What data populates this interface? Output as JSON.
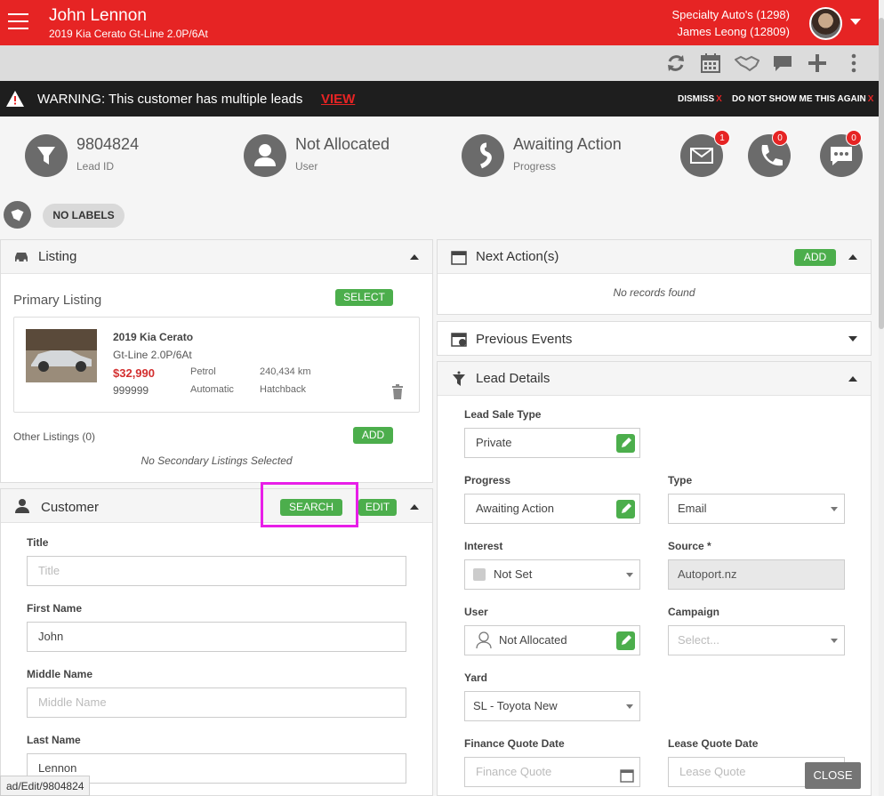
{
  "header": {
    "customer_name": "John Lennon",
    "vehicle": "2019 Kia Cerato Gt-Line 2.0P/6At",
    "dealer": "Specialty Auto's (1298)",
    "user": "James Leong (12809)"
  },
  "toolbar": {
    "icons": [
      "refresh-icon",
      "calendar-icon",
      "handshake-icon",
      "chat-icon",
      "plus-icon",
      "more-vertical-icon"
    ]
  },
  "warning": {
    "text": "WARNING: This customer has multiple leads",
    "view": "VIEW",
    "dismiss": "DISMISS",
    "never_show": "DO NOT SHOW ME THIS AGAIN",
    "x": "X"
  },
  "stats": {
    "lead_id": {
      "value": "9804824",
      "label": "Lead ID"
    },
    "user": {
      "value": "Not Allocated",
      "label": "User"
    },
    "progress": {
      "value": "Awaiting Action",
      "label": "Progress"
    },
    "email_count": "1",
    "call_count": "0",
    "sms_count": "0"
  },
  "labels": {
    "no_labels": "NO LABELS"
  },
  "listing": {
    "title": "Listing",
    "primary_label": "Primary Listing",
    "select": "SELECT",
    "car_title": "2019 Kia Cerato",
    "car_variant": "Gt-Line 2.0P/6At",
    "price": "$32,990",
    "stock": "999999",
    "fuel": "Petrol",
    "transmission": "Automatic",
    "odometer": "240,434 km",
    "body": "Hatchback",
    "other_label": "Other Listings (0)",
    "add": "ADD",
    "no_secondary": "No Secondary Listings Selected"
  },
  "customer": {
    "title": "Customer",
    "search": "SEARCH",
    "edit": "EDIT",
    "fields": {
      "title_label": "Title",
      "title_placeholder": "Title",
      "first_label": "First Name",
      "first_value": "John",
      "middle_label": "Middle Name",
      "middle_placeholder": "Middle Name",
      "last_label": "Last Name",
      "last_value": "Lennon"
    }
  },
  "next_actions": {
    "title": "Next Action(s)",
    "add": "ADD",
    "empty": "No records found"
  },
  "previous_events": {
    "title": "Previous Events"
  },
  "lead_details": {
    "title": "Lead Details",
    "sale_type_label": "Lead Sale Type",
    "sale_type_value": "Private",
    "progress_label": "Progress",
    "progress_value": "Awaiting Action",
    "type_label": "Type",
    "type_value": "Email",
    "interest_label": "Interest",
    "interest_value": "Not Set",
    "source_label": "Source *",
    "source_value": "Autoport.nz",
    "user_label": "User",
    "user_value": "Not Allocated",
    "campaign_label": "Campaign",
    "campaign_placeholder": "Select...",
    "yard_label": "Yard",
    "yard_value": "SL - Toyota New",
    "finance_label": "Finance Quote Date",
    "finance_placeholder": "Finance Quote",
    "lease_label": "Lease Quote Date",
    "lease_placeholder": "Lease Quote"
  },
  "footer": {
    "close": "CLOSE",
    "status_url": "ad/Edit/9804824"
  },
  "colors": {
    "brand_red": "#e62424",
    "accent_green": "#4cae4c",
    "highlight_magenta": "#e81ee8"
  }
}
